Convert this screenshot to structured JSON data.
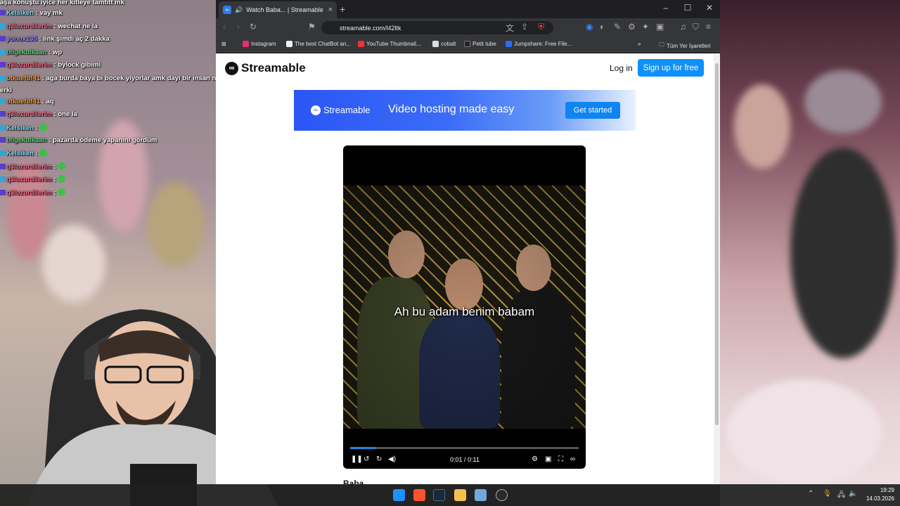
{
  "chat": [
    {
      "user": "",
      "msg": "aşa konuştu iyice her kitleye tamtitt mk"
    },
    {
      "user": "Kelsiken",
      "msg": ": vay mk",
      "user_color": "#7fe0ff"
    },
    {
      "user": "q3lozurdilerim",
      "msg": ": wechat ne la",
      "user_color": "#ff6b8a"
    },
    {
      "user": "yunox135",
      "msg": ": link şimdi aç 2 dakka",
      "user_color": "#9b8cff"
    },
    {
      "user": "bilgekulkaan",
      "msg": ": wp",
      "user_color": "#59d97a"
    },
    {
      "user": "q3lozurdilerim",
      "msg": ": bylock gibimi",
      "user_color": "#ff6b8a"
    },
    {
      "user": "utkuefdf41",
      "msg": ": aga burda baya bi bocek yiyorlar amk dayi bir insan niye bocek",
      "user_color": "#ff9d2e"
    },
    {
      "user": "",
      "msg": "erki"
    },
    {
      "user": "utkuefdf41",
      "msg": ": aq",
      "user_color": "#ff9d2e"
    },
    {
      "user": "q3lozurdilerim",
      "msg": ": one la",
      "user_color": "#ff6b8a"
    },
    {
      "user": "Kelsiken",
      "msg": ":",
      "user_color": "#7fe0ff"
    },
    {
      "user": "bilgekulkaan",
      "msg": ": pazarda ödeme yapanını gördüm",
      "user_color": "#59d97a"
    },
    {
      "user": "Kelsiken",
      "msg": ":",
      "user_color": "#7fe0ff"
    },
    {
      "user": "q3lozurdilerim",
      "msg": ":",
      "user_color": "#ff6b8a"
    },
    {
      "user": "q3lozurdilerim",
      "msg": ":",
      "user_color": "#ff6b8a"
    },
    {
      "user": "q3lozurdilerim",
      "msg": ":",
      "user_color": "#ff6b8a"
    }
  ],
  "browser": {
    "tab_title": "Watch Baba... | Streamable",
    "url": "streamable.com/l42ltk",
    "bookmarks": [
      "Instagram",
      "The best ChatBot an...",
      "YouTube Thumbnail...",
      "cobalt",
      "Petit tube",
      "Jumpshare: Free File...",
      "Tüm Yer İşaretleri"
    ]
  },
  "page": {
    "logo": "Streamable",
    "login": "Log in",
    "signup": "Sign up for free",
    "banner_logo": "Streamable",
    "banner_text": "Video hosting made easy",
    "banner_button": "Get started",
    "subtitle": "Ah bu adam benim babam",
    "time": "0:01 / 0:11",
    "progress_fraction": 0.11,
    "video_title": "Baba"
  },
  "taskbar": {
    "time": "19:29",
    "date": "14.03.2026"
  },
  "colors": {
    "accent": "#0f90fa",
    "banner": "#2a56f5"
  }
}
